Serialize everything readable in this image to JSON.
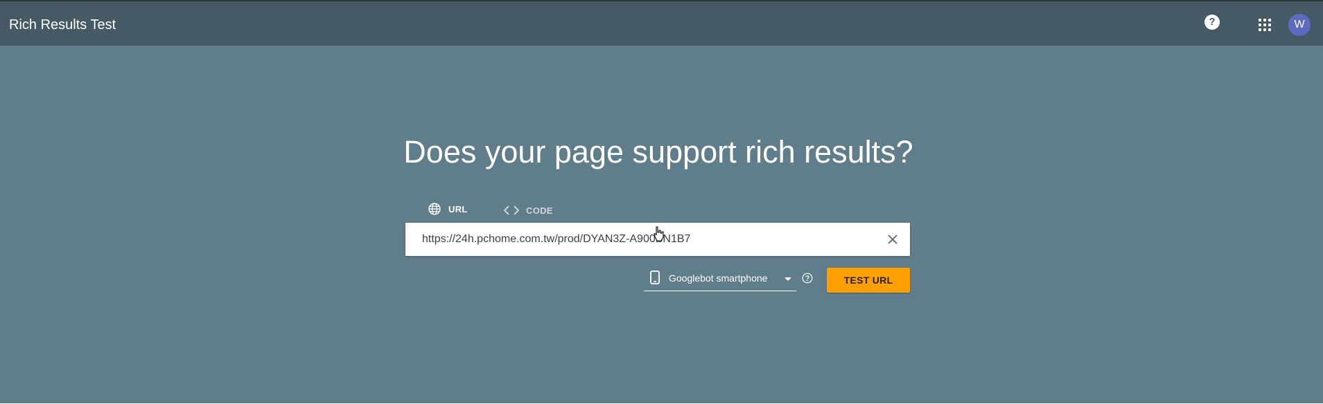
{
  "header": {
    "title": "Rich Results Test",
    "help_icon": "help-circle-icon",
    "help_glyph": "?",
    "apps_icon": "apps-grid-icon",
    "avatar_letter": "W"
  },
  "main": {
    "headline": "Does your page support rich results?",
    "tabs": [
      {
        "label": "URL",
        "icon": "globe-icon",
        "selected": true
      },
      {
        "label": "CODE",
        "icon": "code-brackets-icon",
        "selected": false
      }
    ],
    "url_input": {
      "value": "https://24h.pchome.com.tw/prod/DYAN3Z-A900BN1B7",
      "clear_icon": "close-icon"
    },
    "crawler_select": {
      "icon": "smartphone-icon",
      "selected": "Googlebot smartphone"
    },
    "crawler_help_icon": "help-outline-icon",
    "submit_label": "TEST URL"
  },
  "colors": {
    "header_bg": "#455a64",
    "hero_bg": "#607d8b",
    "accent": "#ffa000",
    "avatar_bg": "#5c6bc0"
  }
}
